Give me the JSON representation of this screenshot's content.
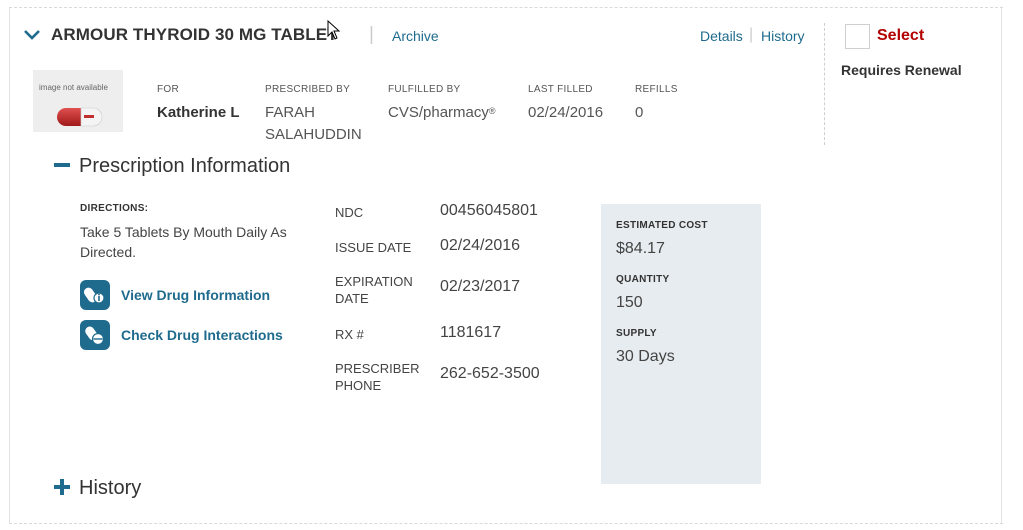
{
  "header": {
    "drug_name": "ARMOUR THYROID 30 MG TABLET",
    "archive_label": "Archive",
    "details_label": "Details",
    "history_label": "History",
    "select_label": "Select",
    "requires_renewal": "Requires Renewal"
  },
  "image": {
    "placeholder_text": "image not available"
  },
  "meta": {
    "for_label": "FOR",
    "for_value": "Katherine L",
    "prescribed_by_label": "PRESCRIBED BY",
    "prescribed_by_line1": "FARAH",
    "prescribed_by_line2": "SALAHUDDIN",
    "fulfilled_by_label": "FULFILLED BY",
    "fulfilled_by_value": "CVS/pharmacy",
    "fulfilled_by_mark": "®",
    "last_filled_label": "LAST FILLED",
    "last_filled_value": "02/24/2016",
    "refills_label": "REFILLS",
    "refills_value": "0"
  },
  "prescription_info": {
    "title": "Prescription Information",
    "toggle_symbol": "−",
    "directions_label": "DIRECTIONS:",
    "directions_text": "Take 5 Tablets By Mouth Daily As Directed.",
    "view_drug_info": "View Drug Information",
    "check_interactions": "Check Drug Interactions",
    "ndc_label": "NDC",
    "ndc_value": "00456045801",
    "issue_date_label": "ISSUE DATE",
    "issue_date_value": "02/24/2016",
    "expiration_label_line1": "EXPIRATION",
    "expiration_label_line2": "DATE",
    "expiration_value": "02/23/2017",
    "rx_label": "RX #",
    "rx_value": "1181617",
    "prescriber_phone_label_line1": "PRESCRIBER",
    "prescriber_phone_label_line2": "PHONE",
    "prescriber_phone_value": "262-652-3500"
  },
  "cost": {
    "estimated_cost_label": "ESTIMATED COST",
    "estimated_cost_value": "$84.17",
    "quantity_label": "QUANTITY",
    "quantity_value": "150",
    "supply_label": "SUPPLY",
    "supply_value": "30 Days"
  },
  "history_section": {
    "title": "History",
    "toggle_symbol": "+"
  },
  "colors": {
    "link": "#1f6b8e",
    "select_red": "#b30000",
    "cost_panel_bg": "#e6ecef"
  },
  "icons": {
    "collapse": "chevron-down-icon",
    "drug_info": "pill-info-icon",
    "interactions": "pill-interaction-icon",
    "cursor": "mouse-pointer-icon"
  }
}
